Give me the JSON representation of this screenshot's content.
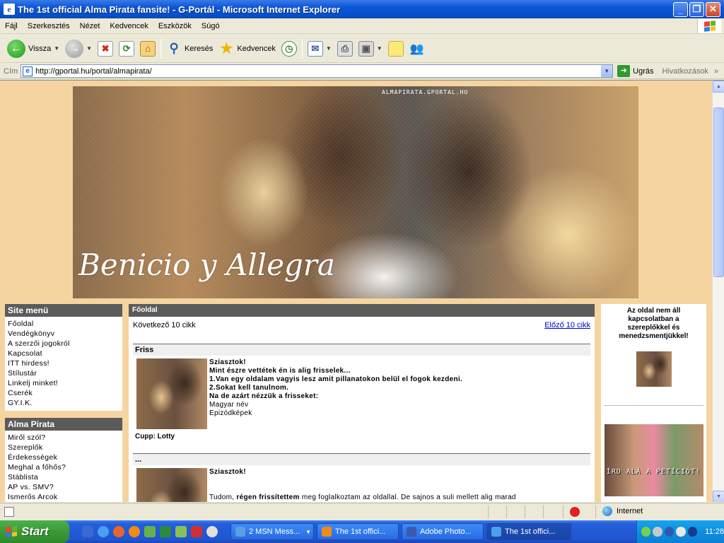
{
  "window": {
    "title": "The 1st official Alma Pirata fansite! - G-Portál - Microsoft Internet Explorer",
    "app_icon": "e"
  },
  "menu": [
    "Fájl",
    "Szerkesztés",
    "Nézet",
    "Kedvencek",
    "Eszközök",
    "Súgó"
  ],
  "toolbar": {
    "back": "Vissza",
    "search": "Keresés",
    "favorites": "Kedvencek"
  },
  "address": {
    "label": "Cím",
    "url": "http://gportal.hu/portal/almapirata/",
    "go": "Ugrás",
    "links": "Hivatkozások"
  },
  "banner": {
    "site": "ALMAPIRATA.GPORTAL.HU",
    "script_title": "Benicio y Allegra"
  },
  "sidebar": {
    "site_menu": {
      "title": "Site menü",
      "items": [
        "Főoldal",
        "Vendégkönyv",
        "A szerzői jogokról",
        "Kapcsolat",
        "ITT hirdess!",
        "Stílustár",
        "Linkelj minket!",
        "Cserék",
        "GY.I.K."
      ]
    },
    "alma_pirata": {
      "title": "Alma Pirata",
      "items": [
        "Miről szól?",
        "Szereplők",
        "Érdekességek",
        "Meghal a főhős?",
        "Stáblista",
        "AP vs. SMV?",
        "Ismerős Arcok"
      ]
    }
  },
  "main": {
    "header": "Főoldal",
    "next": "Következő 10 cikk",
    "prev": "Előző 10 cikk",
    "posts": [
      {
        "title": "Friss",
        "lines": [
          {
            "text": "Sziasztok!",
            "bold": true
          },
          {
            "text": "Mint észre vettétek én is alig frisselek...",
            "bold": true
          },
          {
            "text": "1.Van egy oldalam vagyis lesz amit pillanatokon belül el fogok kezdeni.",
            "bold": true
          },
          {
            "text": "2.Sokat kell tanulnom.",
            "bold": true
          },
          {
            "text": "Na de azárt nézzük a frisseket:",
            "bold": true
          },
          {
            "text": "Magyar név",
            "bold": false
          },
          {
            "text": "Epizódképek",
            "bold": false
          }
        ],
        "signature": "Cupp: Lotty"
      },
      {
        "title": "...",
        "greeting": "Sziasztok!",
        "text_pre": "Tudom, ",
        "text_bold": "régen frissítettem",
        "text_post": " meg foglalkoztam az oldallal. De sajnos a suli mellett alig marad"
      }
    ]
  },
  "right": {
    "notice": "Az oldal nem áll kapcsolatban a szereplőkkel és menedzsmentjükkel!",
    "petition_text": "ÍRD ALÁ A PETÍCIÓT!"
  },
  "status": {
    "zone": "Internet"
  },
  "taskbar": {
    "start": "Start",
    "tasks": [
      {
        "label": "2 MSN Mess...",
        "active": false,
        "dropdown": true
      },
      {
        "label": "The 1st offici...",
        "active": false,
        "dropdown": false
      },
      {
        "label": "Adobe Photo...",
        "active": false,
        "dropdown": false
      },
      {
        "label": "The 1st offici...",
        "active": true,
        "dropdown": false
      }
    ],
    "clock": "11:28"
  },
  "colors": {
    "page_bg": "#f5d4a0",
    "box_header": "#5b5b5b",
    "link": "#0000cc",
    "titlebar": "#0a56d8"
  }
}
